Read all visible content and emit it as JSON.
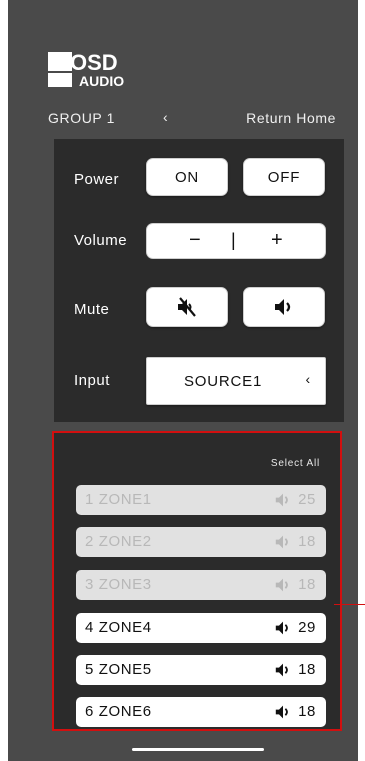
{
  "brand": {
    "logo_top": "OSD",
    "logo_bottom": "AUDIO"
  },
  "header": {
    "group": "GROUP 1",
    "back": "‹",
    "return_home": "Return Home"
  },
  "controls": {
    "power": {
      "label": "Power",
      "on": "ON",
      "off": "OFF"
    },
    "volume": {
      "label": "Volume",
      "minus": "−",
      "separator": "|",
      "plus": "+"
    },
    "mute": {
      "label": "Mute",
      "mute_icon": "speaker-muted-icon",
      "unmute_icon": "speaker-on-icon"
    },
    "input": {
      "label": "Input",
      "source": "SOURCE1",
      "arrow": "‹"
    }
  },
  "zones": {
    "select_all": "Select All",
    "items": [
      {
        "name": "1 ZONE1",
        "volume": "25",
        "enabled": false
      },
      {
        "name": "2 ZONE2",
        "volume": "18",
        "enabled": false
      },
      {
        "name": "3 ZONE3",
        "volume": "18",
        "enabled": false
      },
      {
        "name": "4 ZONE4",
        "volume": "29",
        "enabled": true
      },
      {
        "name": "5 ZONE5",
        "volume": "18",
        "enabled": true
      },
      {
        "name": "6 ZONE6",
        "volume": "18",
        "enabled": true
      }
    ]
  },
  "colors": {
    "background": "#4a4a4a",
    "panel": "#2b2b2b",
    "highlight_border": "#d20f0f",
    "button": "#ffffff"
  }
}
